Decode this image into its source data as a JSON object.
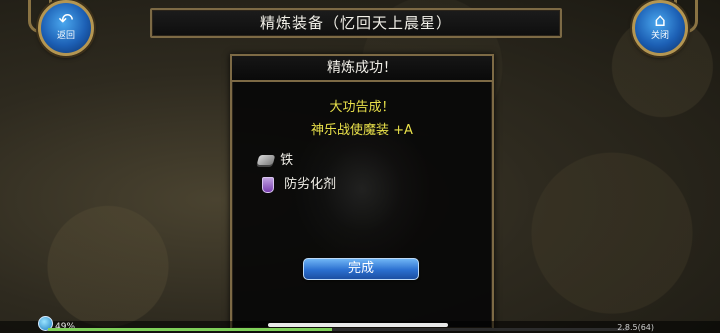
{
  "header": {
    "title": "精炼装备（忆回天上晨星）"
  },
  "buttons": {
    "back_label": "返回",
    "close_label": "关闭"
  },
  "dialog": {
    "title": "精炼成功！",
    "message_line1": "大功告成！",
    "message_line2": "神乐战使魔装 +A",
    "materials": [
      {
        "icon": "iron-ingot-icon",
        "name": "铁"
      },
      {
        "icon": "potion-icon",
        "name": "防劣化剂"
      }
    ],
    "done_label": "完成"
  },
  "status": {
    "progress_text": "49%",
    "progress_fraction": 0.49,
    "version": "2.8.5(64)"
  },
  "colors": {
    "accent_gold": "#7d6a45",
    "message_yellow": "#e8e04a",
    "button_blue": "#2b6fd0"
  }
}
